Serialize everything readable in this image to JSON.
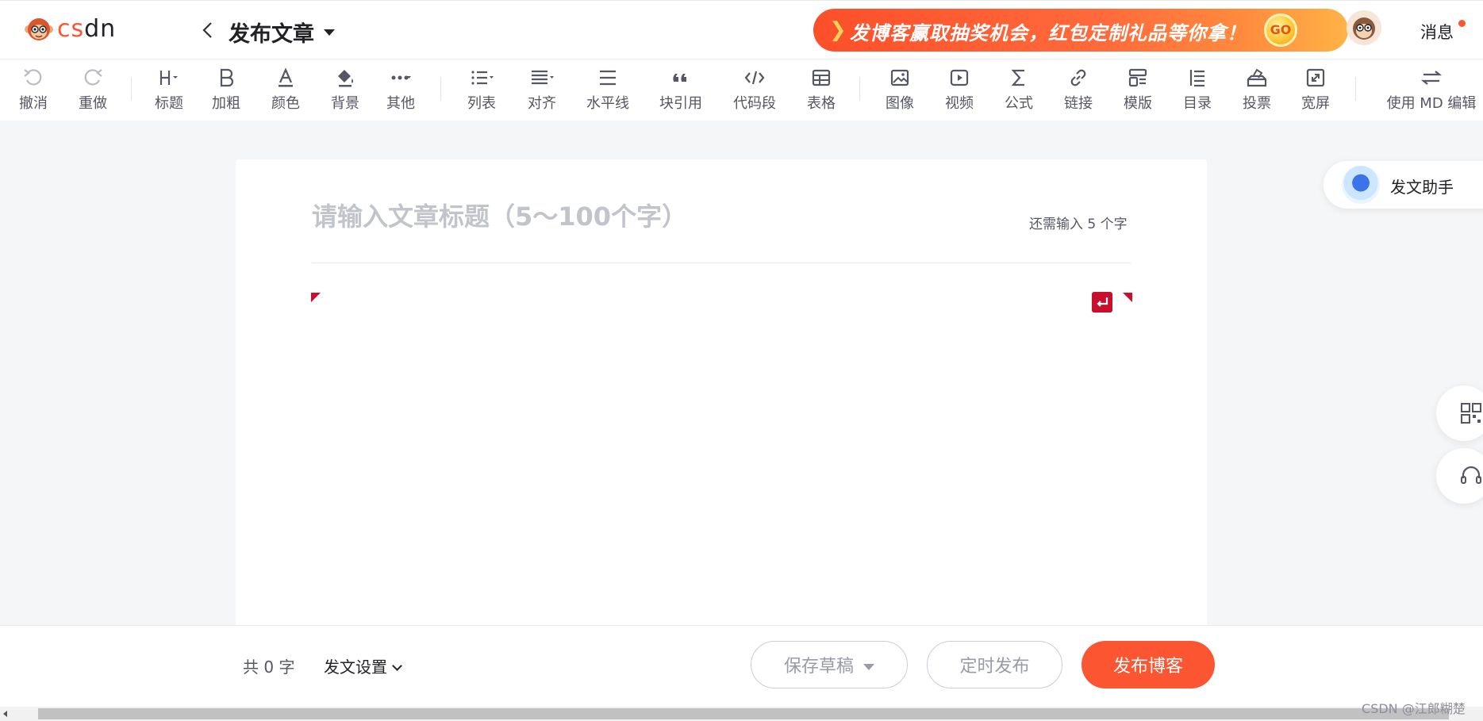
{
  "header": {
    "logo_text_cs": "cs",
    "logo_text_dn": "dn",
    "page_title": "发布文章",
    "banner_text": "发博客赢取抽奖机会，红包定制礼品等你拿！",
    "banner_go": "GO",
    "message_label": "消息"
  },
  "toolbar": {
    "undo": "撤消",
    "redo": "重做",
    "heading": "标题",
    "bold": "加粗",
    "color": "颜色",
    "background": "背景",
    "other": "其他",
    "list": "列表",
    "align": "对齐",
    "hr": "水平线",
    "quote": "块引用",
    "code": "代码段",
    "table": "表格",
    "image": "图像",
    "video": "视频",
    "formula": "公式",
    "link": "链接",
    "template": "模版",
    "toc": "目录",
    "vote": "投票",
    "widescreen": "宽屏",
    "md_editor": "使用 MD 编辑"
  },
  "editor": {
    "title_placeholder": "请输入文章标题（5～100个字）",
    "title_value": "",
    "remaining": "还需输入 5 个字"
  },
  "side": {
    "assistant_label": "发文助手"
  },
  "bottom": {
    "word_count": "共 0 字",
    "settings": "发文设置",
    "save_draft": "保存草稿",
    "timed_publish": "定时发布",
    "publish": "发布博客"
  },
  "watermark": "CSDN @江郎糊楚",
  "colors": {
    "brand": "#fc5531",
    "editor_mark": "#c8102e"
  }
}
